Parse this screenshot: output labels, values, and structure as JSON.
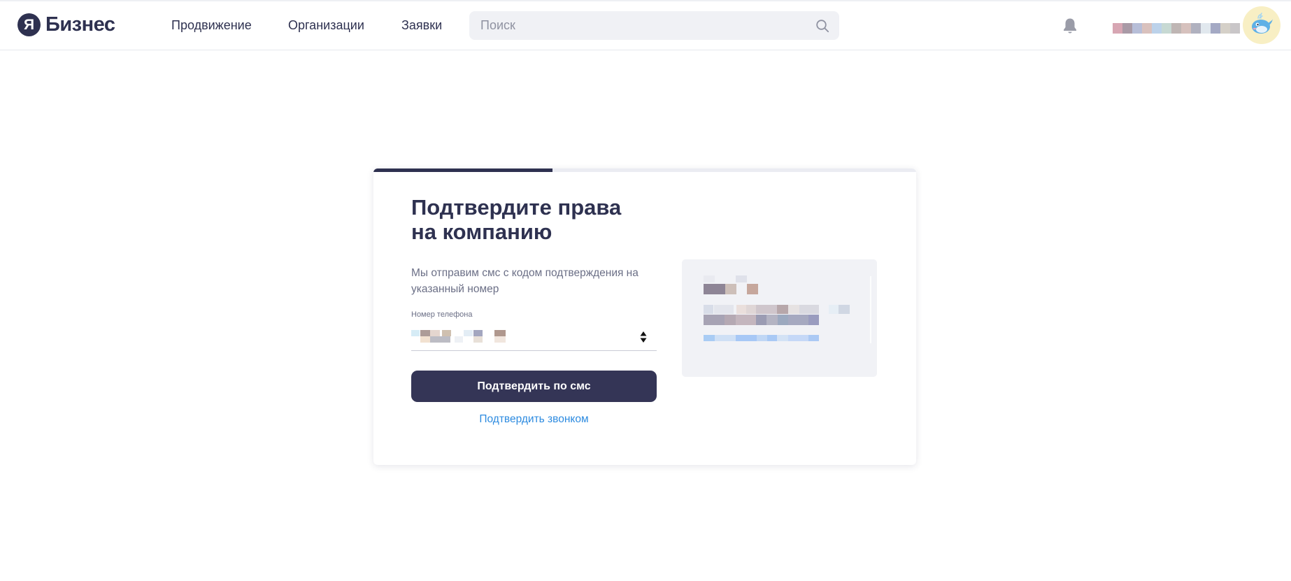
{
  "header": {
    "logo_mark": "Я",
    "logo_text": "Бизнес",
    "nav": [
      {
        "label": "Продвижение"
      },
      {
        "label": "Организации"
      },
      {
        "label": "Заявки"
      }
    ],
    "search": {
      "placeholder": "Поиск",
      "value": ""
    },
    "icons": {
      "search": "search-icon",
      "notifications": "bell-icon",
      "avatar": "whale-avatar-icon"
    }
  },
  "card": {
    "progress": 0.33,
    "title": "Подтвердите права\nна компанию",
    "description": "Мы отправим смс с кодом подтверждения на указанный номер",
    "phone": {
      "label": "Номер телефона",
      "value_redacted": true
    },
    "confirm_sms_button": "Подтвердить по смс",
    "confirm_call_link": "Подтвердить звонком"
  },
  "colors": {
    "brand_dark": "#2e3150",
    "button": "#343556",
    "link": "#2d8be0",
    "muted_text": "#6b6f86",
    "info_box_bg": "#f1f2f6"
  }
}
